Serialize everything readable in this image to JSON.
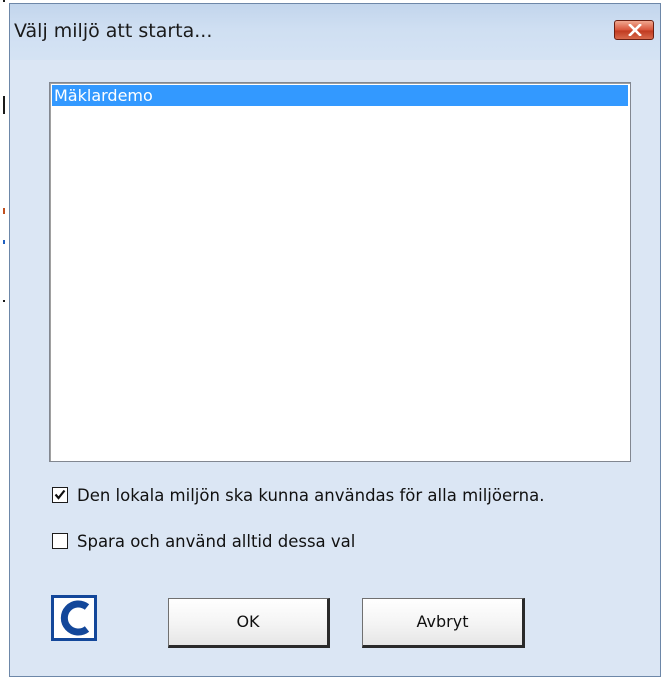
{
  "window": {
    "title": "Välj miljö att starta..."
  },
  "list": {
    "items": [
      "Mäklardemo"
    ],
    "selected_index": 0
  },
  "options": [
    {
      "label": "Den lokala miljön ska kunna användas för alla miljöerna.",
      "checked": true
    },
    {
      "label": "Spara och använd alltid dessa val",
      "checked": false
    }
  ],
  "buttons": {
    "ok_label": "OK",
    "cancel_label": "Avbryt"
  },
  "icons": {
    "close": "close-icon",
    "logo": "c-logo-icon",
    "check": "checkmark-icon"
  },
  "colors": {
    "dialog_background": "#dbe6f4",
    "selection": "#3399ff",
    "close_button": "#c9452b",
    "logo_blue": "#13479a"
  }
}
